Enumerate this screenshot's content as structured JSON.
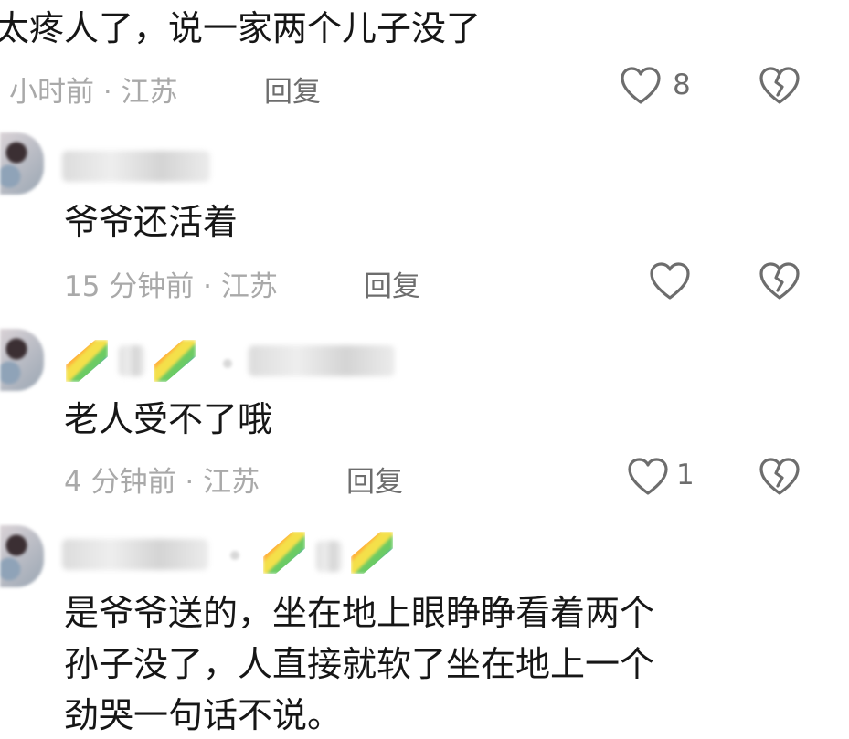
{
  "comments": [
    {
      "text": "太疼人了，说一家两个儿子没了",
      "meta": "小时前 · 江苏",
      "reply_label": "回复",
      "likes": "8"
    },
    {
      "text": "爷爷还活着",
      "meta": "15 分钟前 · 江苏",
      "reply_label": "回复",
      "likes": ""
    },
    {
      "text": "老人受不了哦",
      "meta": "4 分钟前 · 江苏",
      "reply_label": "回复",
      "likes": "1"
    },
    {
      "text_lines": [
        "是爷爷送的，坐在地上眼睁睁看着两个",
        "孙子没了，人直接就软了坐在地上一个",
        "劲哭一句话不说。"
      ]
    }
  ],
  "icons": {
    "like": "heart-outline-icon",
    "dislike": "broken-heart-icon"
  },
  "colors": {
    "text": "#161616",
    "meta": "#a9a9a9",
    "reply": "#6d6d6d",
    "icon": "#6d6d6d"
  }
}
